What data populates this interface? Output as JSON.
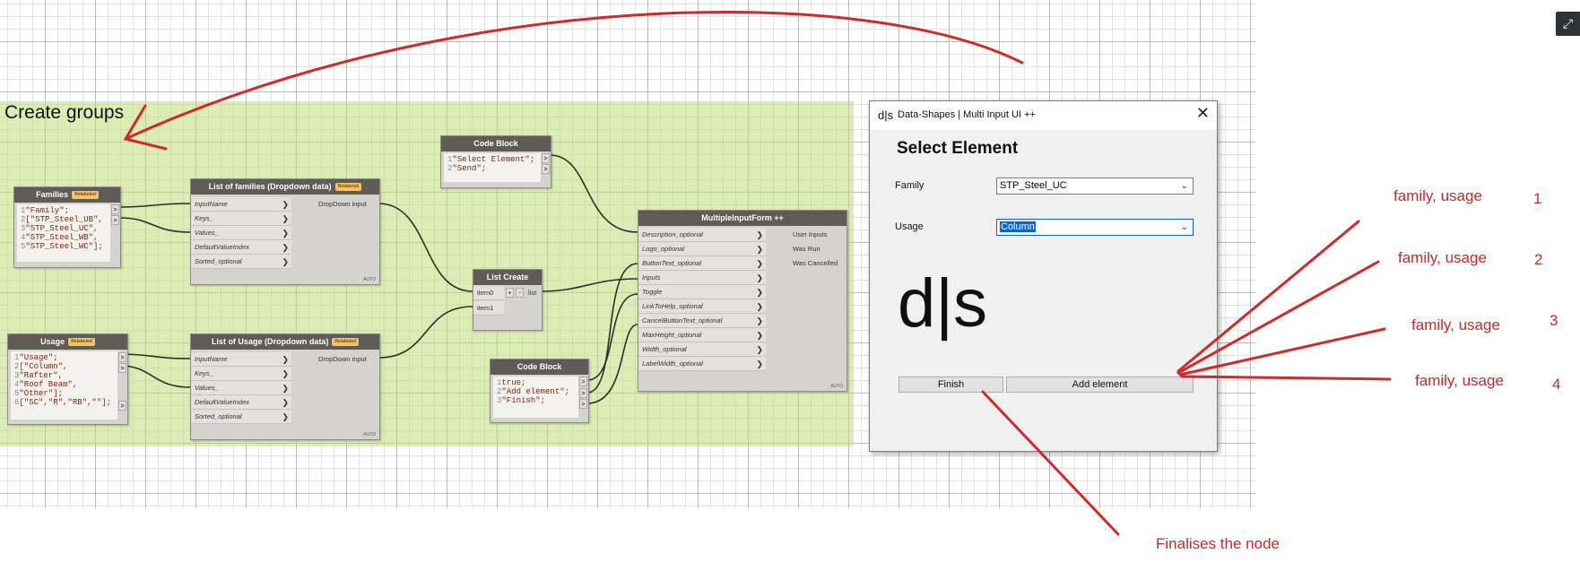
{
  "group": {
    "title": "Create groups"
  },
  "nodes": {
    "families": {
      "title": "Families",
      "badge": "Relabeled",
      "lines": [
        "\"Family\";",
        "[\"STP_Steel_UB\",",
        "\"STP_Steel_UC\",",
        "\"STP_Steel_WB\",",
        "\"STP_Steel_WC\"];"
      ]
    },
    "usage": {
      "title": "Usage",
      "badge": "Relabeled",
      "lines": [
        "\"Usage\";",
        "[\"Column\",",
        "\"Rafter\",",
        "\"Roof Beam\",",
        "\"Other\"];",
        "[\"SC\",\"R\",\"RB\",\"\"];"
      ]
    },
    "list_families": {
      "title": "List of families (Dropdown data)",
      "badge": "Relabeled",
      "inputs": [
        "InputName",
        "Keys_",
        "Values_",
        "DefaultValueIndex",
        "Sorted_optional"
      ],
      "output": "DropDown input",
      "footer": "AUTO"
    },
    "list_usage": {
      "title": "List of Usage (Dropdown data)",
      "badge": "Relabeled",
      "inputs": [
        "InputName",
        "Keys_",
        "Values_",
        "DefaultValueIndex",
        "Sorted_optional"
      ],
      "output": "DropDown input",
      "footer": "AUTO"
    },
    "code_top": {
      "title": "Code Block",
      "lines": [
        "\"Select Element\";",
        "\"Send\";"
      ]
    },
    "list_create": {
      "title": "List Create",
      "inputs": [
        "item0",
        "item1"
      ],
      "plus": "+",
      "minus": "-",
      "output": "list"
    },
    "code_bottom": {
      "title": "Code Block",
      "lines": [
        "true;",
        "\"Add element\";",
        "\"Finish\";"
      ]
    },
    "multi": {
      "title": "MultipleInputForm ++",
      "inputs": [
        "Description_optional",
        "Logo_optional",
        "ButtonText_optional",
        "Inputs",
        "Toggle",
        "LinkToHelp_optional",
        "CancelButtonText_optional",
        "MaxHeight_optional",
        "Width_optional",
        "LabelWidth_optional"
      ],
      "outputs": [
        "User Inputs",
        "Was Run",
        "Was Cancelled"
      ],
      "footer": "AUTO"
    }
  },
  "dialog": {
    "logo": "d|s",
    "title": "Data-Shapes | Multi Input UI ++",
    "close": "✕",
    "heading": "Select Element",
    "family_label": "Family",
    "family_value": "STP_Steel_UC",
    "usage_label": "Usage",
    "usage_value": "Column",
    "big_logo": "d|s",
    "finish_button": "Finish",
    "add_button": "Add element"
  },
  "annotations": {
    "rows": [
      "family,  usage",
      "family,  usage",
      "family,  usage",
      "family,  usage"
    ],
    "numbers": [
      "1",
      "2",
      "3",
      "4"
    ],
    "finalises": "Finalises the node",
    "color": "#c82a2a"
  },
  "expand_icon": "⤢"
}
